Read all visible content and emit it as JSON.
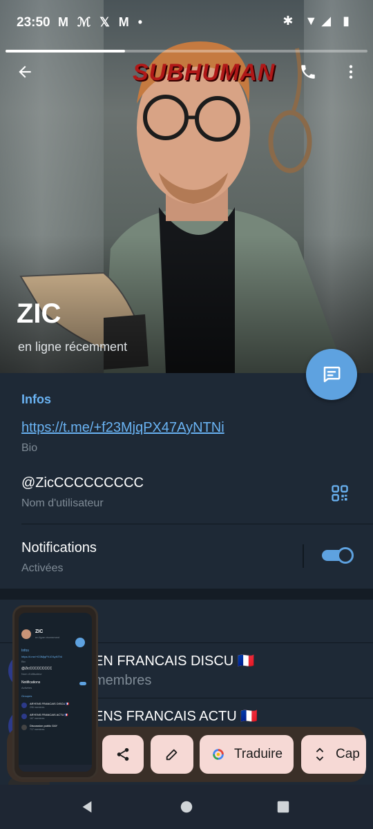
{
  "status_bar": {
    "time": "23:50",
    "notif_icons": "M ℳ 𝕏 M •",
    "right_icons": "✱ ▼◢ ▮"
  },
  "profile": {
    "name": "ZIC",
    "status": "en ligne récemment",
    "photo_overlay_text": "SUBHUMAN"
  },
  "story_progress": 0.33,
  "info": {
    "section_title": "Infos",
    "link": "https://t.me/+f23MjqPX47AyNTNi",
    "link_label": "Bio",
    "username": "@ZicCCCCCCCCC",
    "username_label": "Nom d'utilisateur",
    "notifications": "Notifications",
    "notifications_state": "Activées",
    "notifications_on": true
  },
  "groups": [
    {
      "name": "EN FRANCAIS DISCU 🇫🇷",
      "members": "membres"
    },
    {
      "name": "ENS FRANCAIS ACTU 🇫🇷",
      "members": ""
    }
  ],
  "mini_preview": {
    "name": "ZIC",
    "status": "en ligne récemment",
    "section": "Infos",
    "link": "https://t.me/+f23MjqPX47AyNTNi",
    "link_label": "Bio",
    "username": "@ZicCCCCCCCCC",
    "username_label": "Nom d'utilisateur",
    "notifications": "Notifications",
    "notifications_state": "Activées",
    "groups_title": "Groupes",
    "g1": "ARYENS FRANCAIS DISCU 🇫🇷",
    "g1_sub": "296 membres",
    "g2": "ARYENS FRANCAIS ACTU 🇫🇷",
    "g2_sub": "167 membres",
    "g3": "Discussion public GAY",
    "g3_sub": "717 membres"
  },
  "toolbar": {
    "translate": "Traduire",
    "capture": "Cap"
  },
  "colors": {
    "accent": "#6ab3f3",
    "fab": "#5ea2e0",
    "background": "#17212b",
    "chip": "#f6d9d5"
  }
}
